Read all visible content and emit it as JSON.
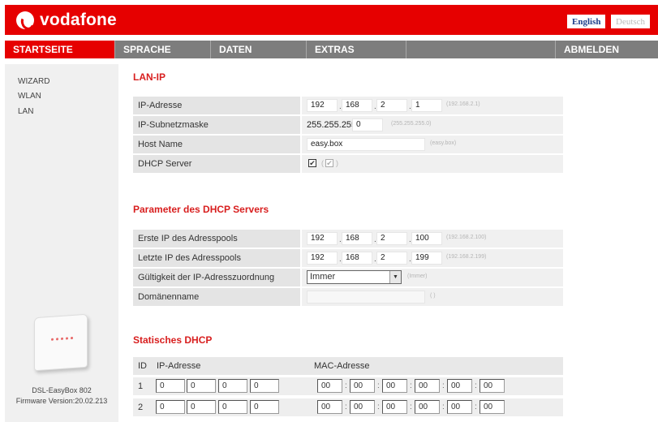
{
  "header": {
    "brand": "vodafone",
    "lang_en": "English",
    "lang_de": "Deutsch"
  },
  "nav": {
    "items": [
      "STARTSEITE",
      "SPRACHE",
      "DATEN",
      "EXTRAS",
      "",
      "ABMELDEN"
    ]
  },
  "sidebar": {
    "links": [
      "WIZARD",
      "WLAN",
      "LAN"
    ],
    "device_name": "DSL-EasyBox 802",
    "firmware": "Firmware Version:20.02.213"
  },
  "lan_ip": {
    "title": "LAN-IP",
    "ip_label": "IP-Adresse",
    "ip": [
      "192",
      "168",
      "2",
      "1"
    ],
    "ip_hint": "(192.168.2.1)",
    "mask_label": "IP-Subnetzmaske",
    "mask_prefix": "255.255.255.",
    "mask_last": "0",
    "mask_hint": "(255.255.255.0)",
    "host_label": "Host Name",
    "host_value": "easy.box",
    "host_hint": "(easy.box)",
    "dhcp_label": "DHCP Server",
    "dhcp_check": "✔",
    "dhcp_hint_open": "(",
    "dhcp_hint_close": ")"
  },
  "dhcp": {
    "title": "Parameter des DHCP Servers",
    "start_label": "Erste IP des Adresspools",
    "start": [
      "192",
      "168",
      "2",
      "100"
    ],
    "start_hint": "(192.168.2.100)",
    "end_label": "Letzte IP des Adresspools",
    "end": [
      "192",
      "168",
      "2",
      "199"
    ],
    "end_hint": "(192.168.2.199)",
    "lease_label": "Gültigkeit der IP-Adresszuordnung",
    "lease_value": "Immer",
    "lease_hint": "(Immer)",
    "domain_label": "Domänenname",
    "domain_value": "",
    "domain_hint": "( )"
  },
  "static_dhcp": {
    "title": "Statisches DHCP",
    "col_id": "ID",
    "col_ip": "IP-Adresse",
    "col_mac": "MAC-Adresse",
    "rows": [
      {
        "id": "1",
        "ip": [
          "0",
          "0",
          "0",
          "0"
        ],
        "mac": [
          "00",
          "00",
          "00",
          "00",
          "00",
          "00"
        ]
      },
      {
        "id": "2",
        "ip": [
          "0",
          "0",
          "0",
          "0"
        ],
        "mac": [
          "00",
          "00",
          "00",
          "00",
          "00",
          "00"
        ]
      }
    ]
  },
  "colors": {
    "brand_red": "#e60000",
    "nav_gray": "#7d7d7d",
    "section_title": "#d81e1e"
  }
}
